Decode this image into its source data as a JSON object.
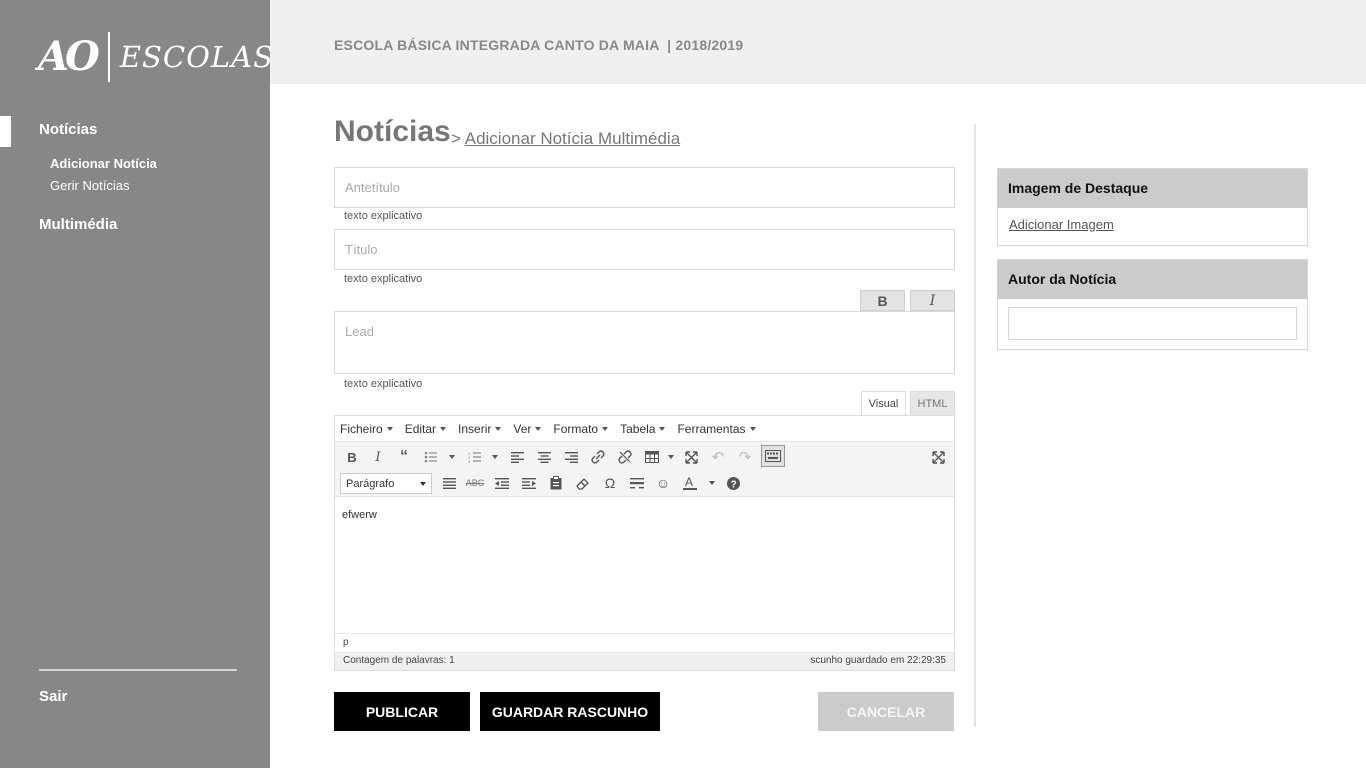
{
  "brand": {
    "logo_mark": "AO",
    "logo_text": "ESCOLAS"
  },
  "sidebar": {
    "nav": [
      {
        "label": "Notícias",
        "active": true
      },
      {
        "label": "Multimédia",
        "active": false
      }
    ],
    "subnav": [
      {
        "label": "Adicionar Notícia",
        "active": true
      },
      {
        "label": "Gerir Notícias",
        "active": false
      }
    ],
    "logout_label": "Sair"
  },
  "header": {
    "title": "ESCOLA BÁSICA INTEGRADA CANTO DA MAIA  | 2018/2019"
  },
  "page": {
    "title": "Notícias",
    "breadcrumb_sep": ">",
    "breadcrumb_link": "Adicionar Notícia Multimédia"
  },
  "form": {
    "antetitulo": {
      "placeholder": "Antetítulo",
      "help": "texto explicativo"
    },
    "titulo": {
      "placeholder": "Título",
      "help": "texto explicativo"
    },
    "lead": {
      "placeholder": "Lead",
      "help": "texto explicativo"
    },
    "lead_buttons": {
      "bold": "B",
      "italic": "I"
    }
  },
  "editor": {
    "tabs": [
      {
        "label": "Visual",
        "active": true
      },
      {
        "label": "HTML",
        "active": false
      }
    ],
    "menus": [
      "Ficheiro",
      "Editar",
      "Inserir",
      "Ver",
      "Formato",
      "Tabela",
      "Ferramentas"
    ],
    "format_select": "Parágrafo",
    "content": "efwerw",
    "path": "p",
    "word_count": "Contagem de palavras: 1",
    "autosave": "scunho guardado em 22:29:35"
  },
  "actions": {
    "publish": "PUBLICAR",
    "save_draft": "GUARDAR RASCUNHO",
    "cancel": "CANCELAR"
  },
  "panels": {
    "featured_image": {
      "title": "Imagem de Destaque",
      "link": "Adicionar Imagem"
    },
    "author": {
      "title": "Autor da Notícia",
      "value": ""
    }
  },
  "colors": {
    "sidebar_bg": "#878787",
    "header_bg": "#f0f0f0",
    "primary_button": "#000000",
    "disabled_button": "#cbcbcb",
    "panel_header": "#cbcbcb"
  }
}
